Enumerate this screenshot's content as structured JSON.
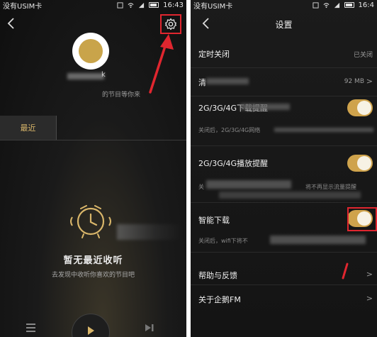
{
  "left_screen": {
    "status": {
      "carrier": "没有USIM卡",
      "time": "16:43"
    },
    "profile": {
      "nickname_fragment": "k",
      "subtitle_fragment": "的节目等你来"
    },
    "tabs": {
      "recent": "最近"
    },
    "empty_state": {
      "title": "暂无最近收听",
      "hint": "去发现中收听你喜欢的节目吧"
    }
  },
  "right_screen": {
    "status": {
      "carrier": "没有USIM卡",
      "time": "16:4"
    },
    "title": "设置",
    "rows": {
      "timer": {
        "label": "定时关闭",
        "value": "已关闭"
      },
      "cache": {
        "label_fragment": "清",
        "value": "92 MB"
      },
      "download_alert": {
        "label": "2G/3G/4G下载提醒",
        "desc": "关闭后，2G/3G/4G网络",
        "toggle_on": true
      },
      "play_alert": {
        "label": "2G/3G/4G播放提醒",
        "desc_prefix": "关",
        "desc_suffix": "将不再显示流量提醒",
        "toggle_on": true
      },
      "smart_download": {
        "label": "智能下载",
        "desc": "关闭后，wifi下将不",
        "toggle_on": true
      },
      "feedback": {
        "label": "帮助与反馈"
      },
      "about": {
        "label": "关于企鹅FM"
      }
    }
  },
  "colors": {
    "accent_gold": "#cfa34c",
    "annotation_red": "#e0262f"
  },
  "icons": [
    "back-icon",
    "gear-icon",
    "alarm-clock-icon",
    "menu-icon",
    "play-icon",
    "next-icon",
    "chevron-right-icon"
  ]
}
